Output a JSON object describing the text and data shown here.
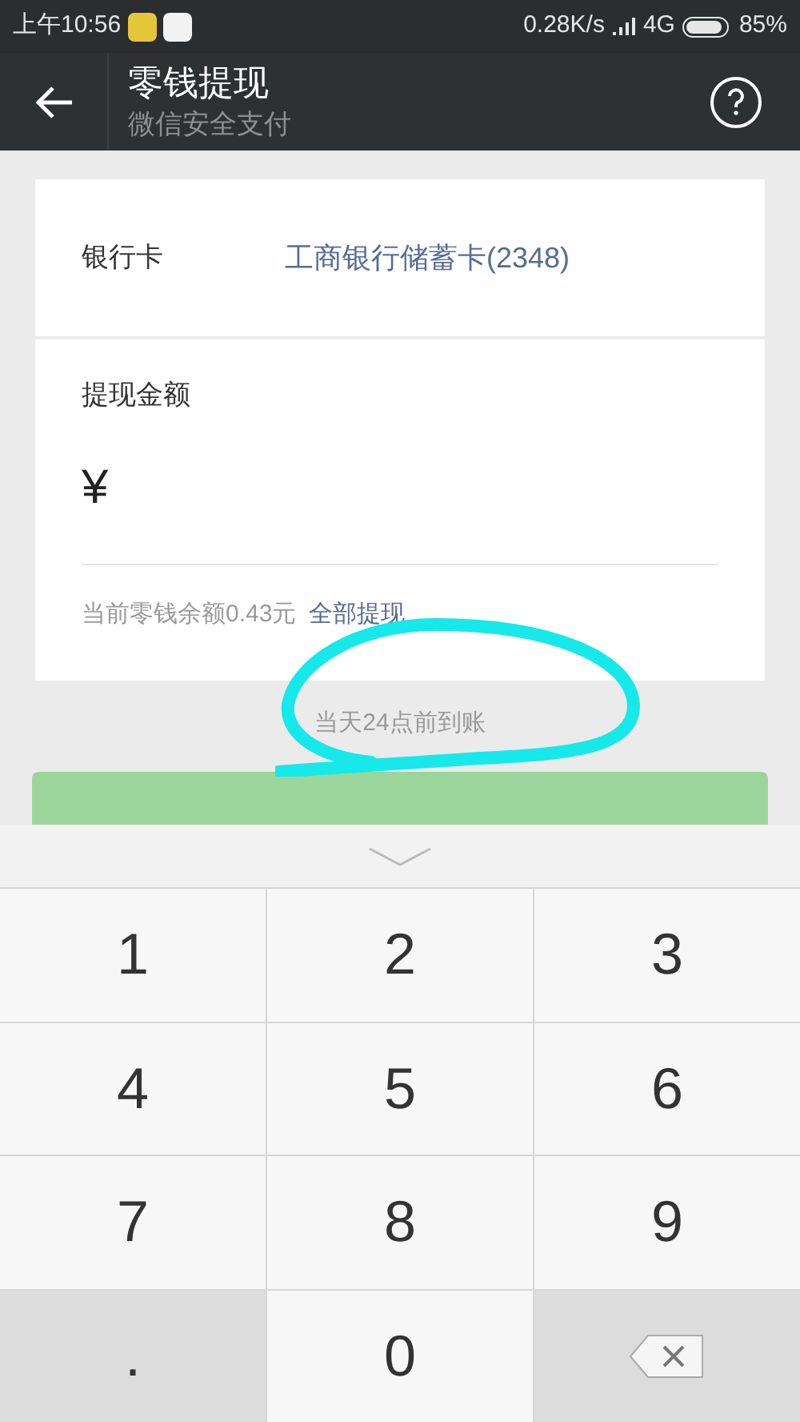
{
  "status_bar": {
    "time": "上午10:56",
    "speed": "0.28K/s",
    "network": "4G",
    "battery": "85%"
  },
  "header": {
    "title": "零钱提现",
    "subtitle": "微信安全支付"
  },
  "bank": {
    "label": "银行卡",
    "value": "工商银行储蓄卡(2348)"
  },
  "amount": {
    "label": "提现金额",
    "currency": "¥",
    "balance": "当前零钱余额0.43元",
    "withdraw_all": "全部提现"
  },
  "note": "当天24点前到账",
  "submit": {
    "disabled": true
  },
  "keypad": [
    {
      "kind": "digit",
      "label": "1"
    },
    {
      "kind": "digit",
      "label": "2"
    },
    {
      "kind": "digit",
      "label": "3"
    },
    {
      "kind": "digit",
      "label": "4"
    },
    {
      "kind": "digit",
      "label": "5"
    },
    {
      "kind": "digit",
      "label": "6"
    },
    {
      "kind": "digit",
      "label": "7"
    },
    {
      "kind": "digit",
      "label": "8"
    },
    {
      "kind": "digit",
      "label": "9"
    },
    {
      "kind": "dot",
      "label": "."
    },
    {
      "kind": "digit",
      "label": "0"
    },
    {
      "kind": "delete"
    }
  ]
}
